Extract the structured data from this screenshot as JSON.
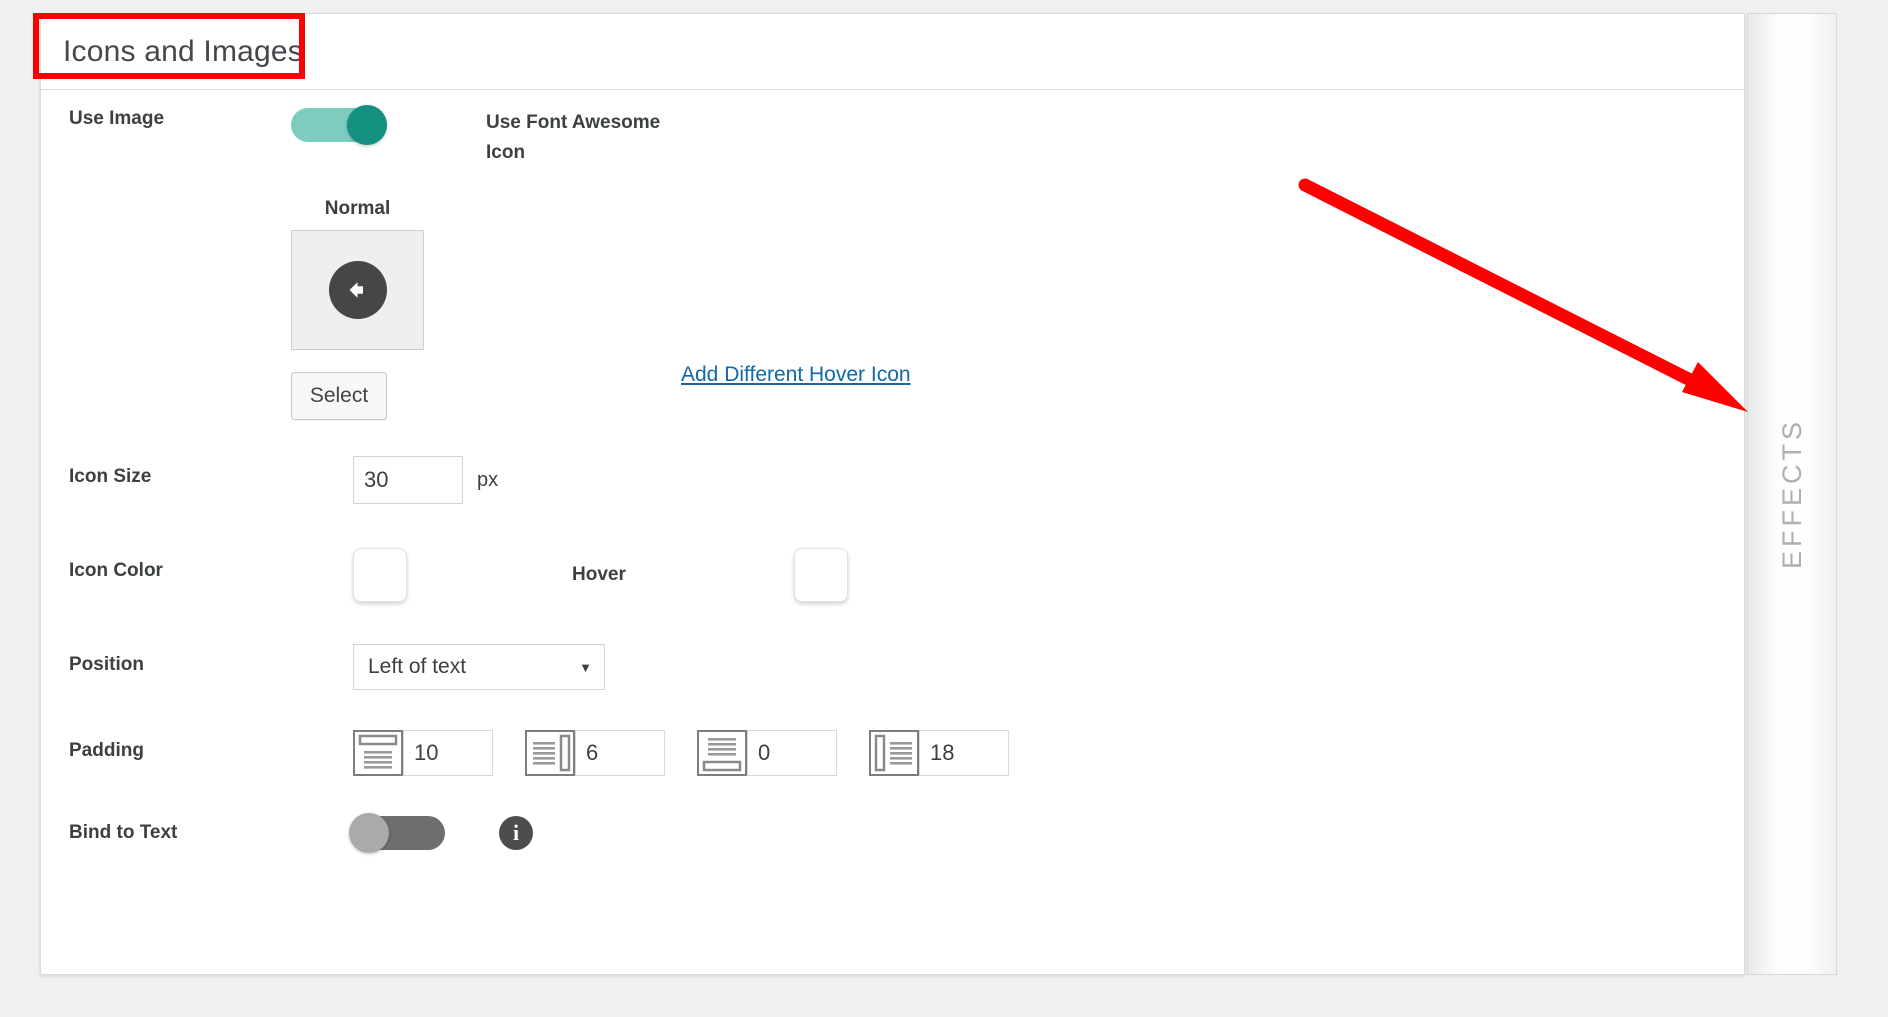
{
  "panel": {
    "title": "Icons and Images",
    "rows": {
      "use_image": {
        "label": "Use Image",
        "toggle_state": "on",
        "side_label": "Use Font Awesome Icon"
      },
      "icon_preview": {
        "caption": "Normal",
        "icon_name": "arrow-circle-left-icon",
        "select_button": "Select",
        "hover_link": "Add Different Hover Icon"
      },
      "icon_size": {
        "label": "Icon Size",
        "value": "30",
        "unit": "px"
      },
      "icon_color": {
        "label": "Icon Color",
        "normal_color": "#ffffff",
        "hover_label": "Hover",
        "hover_color": "#ffffff"
      },
      "position": {
        "label": "Position",
        "value": "Left of text",
        "options": [
          "Left of text"
        ]
      },
      "padding": {
        "label": "Padding",
        "fields": [
          {
            "side": "top",
            "icon": "padding-top-icon",
            "value": "10"
          },
          {
            "side": "right",
            "icon": "padding-right-icon",
            "value": "6"
          },
          {
            "side": "bottom",
            "icon": "padding-bottom-icon",
            "value": "0"
          },
          {
            "side": "left",
            "icon": "padding-left-icon",
            "value": "18"
          }
        ]
      },
      "bind_to_text": {
        "label": "Bind to Text",
        "toggle_state": "off",
        "info_icon": "info-icon",
        "info_glyph": "i"
      }
    }
  },
  "effects_tab": {
    "label": "EFFECTS"
  },
  "annotations": {
    "highlight_color": "#ff0000",
    "arrow_color": "#ff0000"
  },
  "colors": {
    "toggle_on_track": "#7ecbc0",
    "toggle_on_knob": "#13907f",
    "toggle_off_track": "#6e6e6e",
    "toggle_off_knob": "#aaaaaa",
    "link": "#1268a8",
    "background": "#f0f0f0"
  }
}
